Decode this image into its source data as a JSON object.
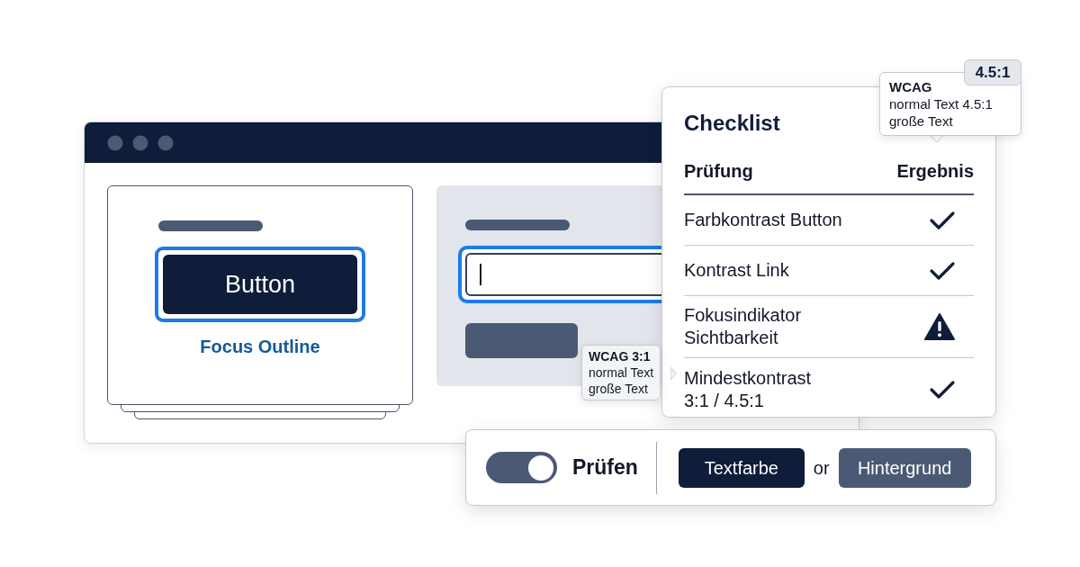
{
  "browser_window": {
    "card": {
      "button": {
        "label": "Button",
        "focused": true
      },
      "caption": "Focus Outline"
    },
    "form_panel": {
      "input": {
        "focused": true
      }
    }
  },
  "checklist": {
    "title": "Checklist",
    "columns": [
      "Prüfung",
      "Ergebnis"
    ],
    "rows": [
      {
        "lines": [
          "Farbkontrast Button"
        ],
        "kind": "check"
      },
      {
        "lines": [
          "Kontrast Link"
        ],
        "kind": "check"
      },
      {
        "lines": [
          "Fokusindikator",
          "Sichtbarkeit"
        ],
        "kind": "warning"
      },
      {
        "lines": [
          "Mindestkontrast",
          "3:1 / 4.5:1"
        ],
        "kind": "check"
      }
    ]
  },
  "tooltips": [
    {
      "lines": [
        "WCAG",
        "normal Text 4.5:1",
        "große Text"
      ],
      "badge": "4.5:1"
    },
    {
      "lines": [
        "WCAG 3:1",
        "normal Text",
        "große Text"
      ]
    }
  ],
  "toolbar": {
    "toggle": {
      "on": true
    },
    "label": "Prüfen",
    "buttons": [
      {
        "label": "Textfarbe",
        "kind": "primary"
      },
      {
        "label": "Hintergrund",
        "kind": "secondary"
      }
    ],
    "connector": "or"
  }
}
